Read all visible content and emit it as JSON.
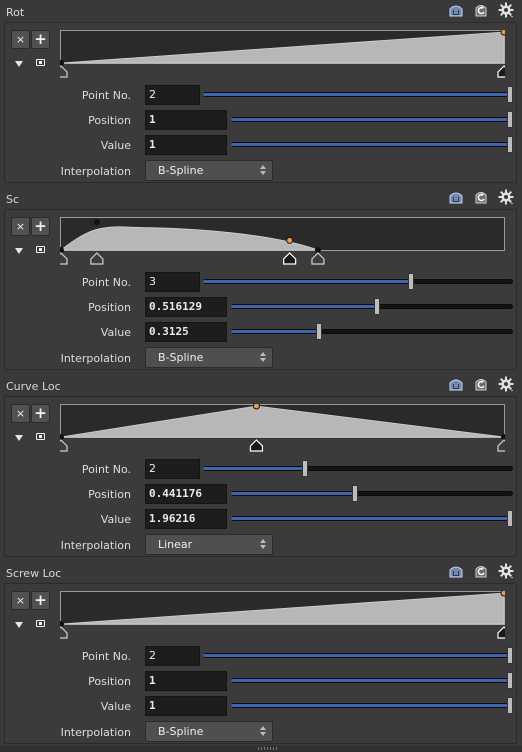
{
  "colors": {
    "accent": "#3f63ad",
    "selected_point": "#e8a04a",
    "ramp_fill": "#b7b7b7",
    "ramp_bg": "#2a2a2a"
  },
  "icons": {
    "header": [
      "preset-icon",
      "reset-icon",
      "gear-icon"
    ],
    "remove": "x-icon",
    "add": "plus-icon"
  },
  "labels": {
    "point_no": "Point No.",
    "position": "Position",
    "value": "Value",
    "interpolation": "Interpolation"
  },
  "buttons": {
    "remove": "×",
    "add": "+"
  },
  "panels": [
    {
      "title": "Rot",
      "point_no": "2",
      "position": "1",
      "value": "1",
      "interpolation": "B-Spline",
      "point_no_slider": 1.0,
      "position_slider": 1.0,
      "value_slider": 1.0,
      "ramp": {
        "kind": "linear",
        "points": [
          {
            "x": 0,
            "y": 0
          },
          {
            "x": 1,
            "y": 1
          }
        ],
        "selected": 1
      }
    },
    {
      "title": "Sc",
      "point_no": "3",
      "position": "0.516129",
      "value": "0.3125",
      "interpolation": "B-Spline",
      "point_no_slider": 0.67,
      "position_slider": 0.516129,
      "value_slider": 0.3125,
      "ramp": {
        "kind": "bspline",
        "points": [
          {
            "x": 0,
            "y": 0
          },
          {
            "x": 0.081,
            "y": 0.9
          },
          {
            "x": 0.516129,
            "y": 0.3125
          },
          {
            "x": 0.58,
            "y": 0
          }
        ],
        "selected": 2
      }
    },
    {
      "title": "Curve Loc",
      "point_no": "2",
      "position": "0.441176",
      "value": "1.96216",
      "interpolation": "Linear",
      "point_no_slider": 0.33,
      "position_slider": 0.441176,
      "value_slider": 1.0,
      "ramp": {
        "kind": "linear",
        "points": [
          {
            "x": 0,
            "y": 0
          },
          {
            "x": 0.441176,
            "y": 1
          },
          {
            "x": 1,
            "y": 0
          }
        ],
        "selected": 1
      }
    },
    {
      "title": "Screw Loc",
      "point_no": "2",
      "position": "1",
      "value": "1",
      "interpolation": "B-Spline",
      "point_no_slider": 1.0,
      "position_slider": 1.0,
      "value_slider": 1.0,
      "ramp": {
        "kind": "linear",
        "points": [
          {
            "x": 0,
            "y": 0
          },
          {
            "x": 1,
            "y": 1
          }
        ],
        "selected": 1
      }
    }
  ]
}
